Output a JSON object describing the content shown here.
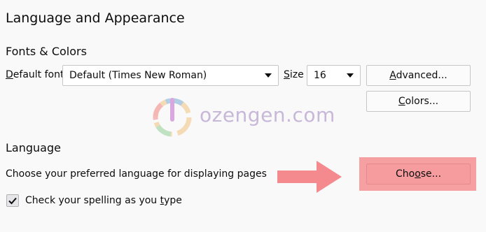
{
  "page_title": "Language and Appearance",
  "fonts_colors": {
    "heading": "Fonts & Colors",
    "default_font_label_prefix": "",
    "default_font_label_u": "D",
    "default_font_label_rest": "efault font",
    "default_font_value": "Default (Times New Roman)",
    "size_label_u": "S",
    "size_label_rest": "ize",
    "size_value": "16",
    "advanced_u": "A",
    "advanced_rest": "dvanced...",
    "colors_u": "C",
    "colors_rest": "olors..."
  },
  "language": {
    "heading": "Language",
    "description": "Choose your preferred language for displaying pages",
    "choose_pre": "Cho",
    "choose_u": "o",
    "choose_rest": "se...",
    "spelling_pre": "Check your spelling as you ",
    "spelling_u": "t",
    "spelling_rest": "ype",
    "spelling_checked": true
  },
  "watermark": {
    "text": "ozengen.com"
  },
  "colors": {
    "highlight": "#f7a0a1",
    "arrow": "#f48a8d"
  },
  "icons": [
    "checkmark-icon",
    "dropdown-caret-icon",
    "arrow-icon"
  ]
}
